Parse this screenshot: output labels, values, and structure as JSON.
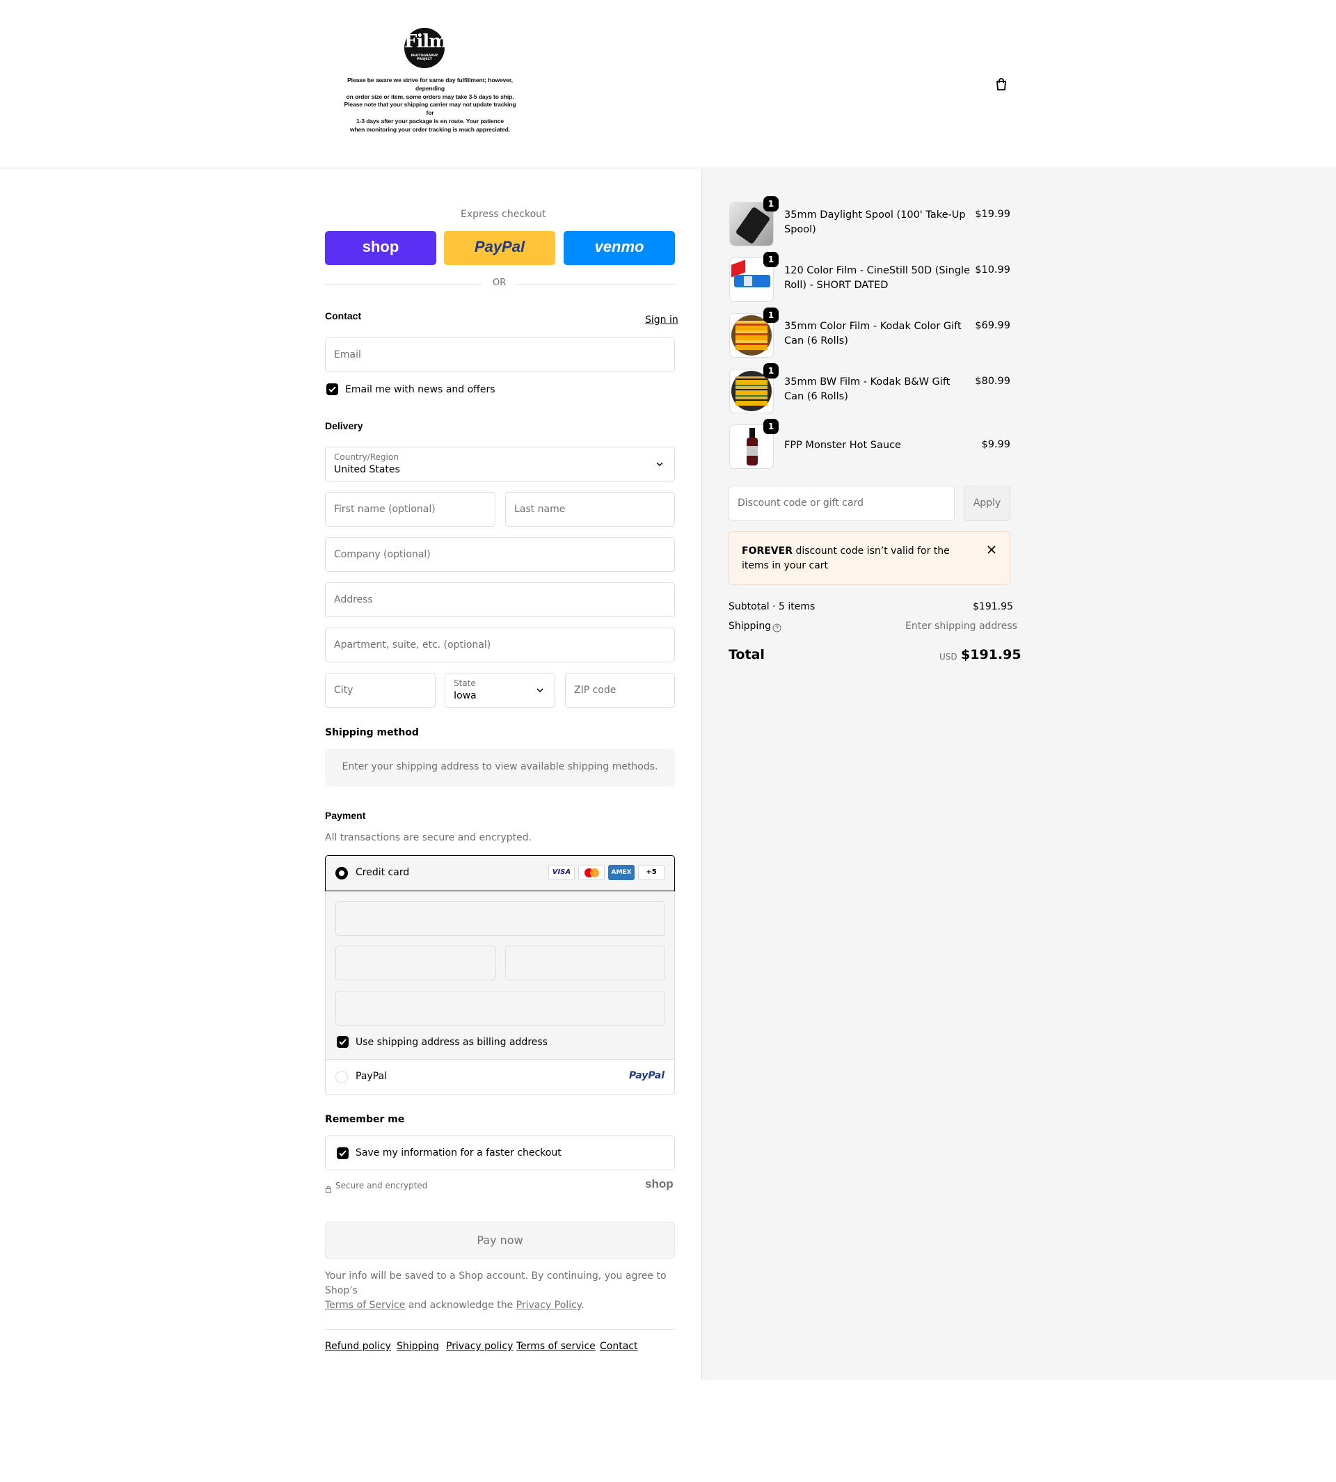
{
  "header": {
    "logo_main": "Film",
    "logo_sub": "PHOTOGRAPHY PROJECT",
    "shipping_note": [
      "Please be aware we strive for same day fulfillment; however, depending",
      "on order size or item, some orders may take 3-5 days to ship.",
      "Please note that your shipping carrier may not update tracking for",
      "1-3 days after your package is en route. Your patience",
      "when monitoring your order tracking is much appreciated."
    ],
    "cart_icon": "shopping-bag-icon"
  },
  "express": {
    "title": "Express checkout",
    "buttons": [
      {
        "label": "shop",
        "color": "#5a31f4"
      },
      {
        "label": "PayPal",
        "color": "#ffc439"
      },
      {
        "label": "venmo",
        "color": "#008cff"
      }
    ],
    "divider": "OR"
  },
  "contact": {
    "title": "Contact",
    "sign_in": "Sign in",
    "email_placeholder": "Email",
    "news_checkbox": "Email me with news and offers"
  },
  "delivery": {
    "title": "Delivery",
    "country_label": "Country/Region",
    "country_value": "United States",
    "first_name_placeholder": "First name (optional)",
    "last_name_placeholder": "Last name",
    "company_placeholder": "Company (optional)",
    "address_placeholder": "Address",
    "apartment_placeholder": "Apartment, suite, etc. (optional)",
    "city_placeholder": "City",
    "state_label": "State",
    "state_value": "Iowa",
    "zip_placeholder": "ZIP code"
  },
  "shipping_method": {
    "title": "Shipping method",
    "message": "Enter your shipping address to view available shipping methods."
  },
  "payment": {
    "title": "Payment",
    "subtitle": "All transactions are secure and encrypted.",
    "credit_card_label": "Credit card",
    "card_brands": [
      "VISA",
      "Mastercard",
      "AMEX",
      "+5"
    ],
    "billing_checkbox": "Use shipping address as billing address",
    "paypal_label": "PayPal",
    "paypal_logo": "PayPal"
  },
  "remember": {
    "title": "Remember me",
    "save_checkbox": "Save my information for a faster checkout",
    "secure_text": "Secure and encrypted",
    "shop_logo": "shop"
  },
  "pay_button": "Pay now",
  "legal": {
    "line1": "Your info will be saved to a Shop account. By continuing, you agree to Shop’s",
    "terms": "Terms of Service",
    "middle": " and acknowledge the ",
    "privacy": "Privacy Policy",
    "end": "."
  },
  "footer_links": [
    "Refund policy",
    "Shipping",
    "Privacy policy",
    "Terms of service",
    "Contact"
  ],
  "summary": {
    "items": [
      {
        "name": "35mm Daylight Spool (100' Take-Up Spool)",
        "price": "$19.99",
        "qty": "1"
      },
      {
        "name": "120 Color Film - CineStill 50D (Single Roll) - SHORT DATED",
        "price": "$10.99",
        "qty": "1"
      },
      {
        "name": "35mm Color Film - Kodak Color Gift Can (6 Rolls)",
        "price": "$69.99",
        "qty": "1"
      },
      {
        "name": "35mm BW Film - Kodak B&W Gift Can (6 Rolls)",
        "price": "$80.99",
        "qty": "1"
      },
      {
        "name": "FPP Monster Hot Sauce",
        "price": "$9.99",
        "qty": "1"
      }
    ],
    "discount_placeholder": "Discount code or gift card",
    "apply_label": "Apply",
    "alert_code": "FOREVER",
    "alert_text": " discount code isn’t valid for the items in your cart",
    "subtotal_label": "Subtotal · 5 items",
    "subtotal_value": "$191.95",
    "shipping_label": "Shipping",
    "shipping_value": "Enter shipping address",
    "total_label": "Total",
    "currency": "USD",
    "total_value": "$191.95"
  }
}
